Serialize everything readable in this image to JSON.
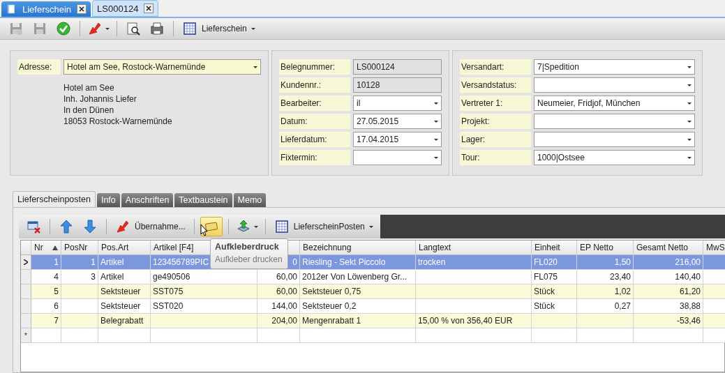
{
  "doc_tabs": [
    {
      "label": "Lieferschein",
      "selected": false
    },
    {
      "label": "LS000124",
      "selected": true
    }
  ],
  "toolbar": {
    "layout_button": "Lieferschein"
  },
  "address": {
    "label": "Adresse:",
    "value": "Hotel am See, Rostock-Warnemünde",
    "lines": [
      "Hotel am See",
      "Inh. Johannis Liefer",
      "In den Dünen",
      "18053 Rostock-Warnemünde"
    ]
  },
  "fields_middle": [
    {
      "label": "Belegnummer:",
      "value": "LS000124",
      "kind": "readonly"
    },
    {
      "label": "Kundennr.:",
      "value": "10128",
      "kind": "readonly"
    },
    {
      "label": "Bearbeiter:",
      "value": "il",
      "kind": "dropdown"
    },
    {
      "label": "Datum:",
      "value": "27.05.2015",
      "kind": "dropdown"
    },
    {
      "label": "Lieferdatum:",
      "value": "17.04.2015",
      "kind": "dropdown"
    },
    {
      "label": "Fixtermin:",
      "kind": "dropdown"
    }
  ],
  "fields_right": [
    {
      "label": "Versandart:",
      "value": "7|Spedition",
      "kind": "dropdown"
    },
    {
      "label": "Versandstatus:",
      "kind": "dropdown"
    },
    {
      "label": "Vertreter 1:",
      "value": "Neumeier, Fridjof, München",
      "kind": "dropdown"
    },
    {
      "label": "Projekt:",
      "kind": "dropdown"
    },
    {
      "label": "Lager:",
      "kind": "dropdown"
    },
    {
      "label": "Tour:",
      "value": "1000|Ostsee",
      "kind": "dropdown"
    }
  ],
  "section_tabs": [
    {
      "label": "Lieferscheinposten",
      "selected": true
    },
    {
      "label": "Info",
      "selected": false
    },
    {
      "label": "Anschriften",
      "selected": false
    },
    {
      "label": "Textbaustein",
      "selected": false
    },
    {
      "label": "Memo",
      "selected": false
    }
  ],
  "grid_toolbar": {
    "takeover_button": "Übernahme...",
    "layout_button": "LieferscheinPosten",
    "sticker_pressed": true
  },
  "tooltip": {
    "title": "Aufkleberdruck",
    "text": "Aufkleber drucken"
  },
  "table": {
    "columns": [
      {
        "label": "Nr",
        "sorted": true
      },
      {
        "label": "PosNr"
      },
      {
        "label": "Pos.Art"
      },
      {
        "label": "Artikel [F4]"
      },
      {},
      {
        "label": "Bezeichnung"
      },
      {
        "label": "Langtext"
      },
      {
        "label": "Einheit"
      },
      {
        "label": "EP Netto"
      },
      {
        "label": "Gesamt Netto"
      },
      {
        "label": "MwS"
      }
    ],
    "rows": [
      {
        "selected": true,
        "cells": [
          "1",
          "1",
          "Artikel",
          "123456789PIC",
          "0",
          "Riesling - Sekt Piccolo",
          "trocken",
          "FL020",
          "1,50",
          "216,00",
          null
        ]
      },
      {
        "selected": false,
        "cells": [
          "4",
          "3",
          "Artikel",
          "ge490506",
          "60,00",
          "2012er Von Löwenberg Gr...",
          null,
          "FL075",
          "23,40",
          "140,40",
          null
        ]
      },
      {
        "selected": false,
        "cells": [
          "5",
          null,
          "Sektsteuer",
          "SST075",
          "60,00",
          "Sektsteuer 0,75",
          null,
          "Stück",
          "1,02",
          "61,20",
          null
        ]
      },
      {
        "selected": false,
        "cells": [
          "6",
          null,
          "Sektsteuer",
          "SST020",
          "144,00",
          "Sektsteuer 0,2",
          null,
          "Stück",
          "0,27",
          "38,88",
          null
        ]
      },
      {
        "selected": false,
        "cells": [
          "7",
          null,
          "Belegrabatt",
          null,
          "204,00",
          "Mengenrabatt 1",
          "15,00 % von 356,40 EUR",
          null,
          null,
          "-53,46",
          null
        ]
      }
    ],
    "new_row_marker": "*"
  }
}
